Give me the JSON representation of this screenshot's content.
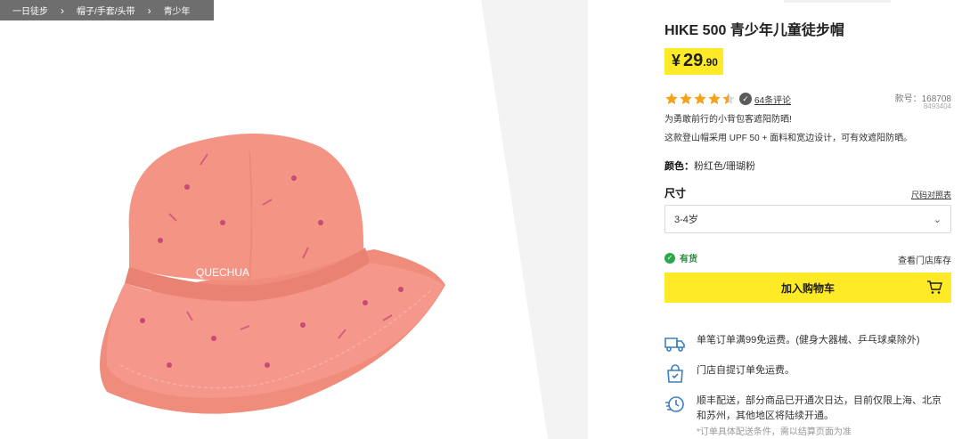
{
  "breadcrumb": [
    "一日徒步",
    "帽子/手套/头带",
    "青少年"
  ],
  "product": {
    "title": "HIKE 500 青少年儿童徒步帽",
    "price_currency": "¥",
    "price_int": "29",
    "price_dec": ".90",
    "rating": 4.5,
    "review_count": "64",
    "review_link": "64条评论",
    "item_no_label": "款号：168708",
    "item_code": "8493404",
    "tagline": "为勇敢前行的小背包客遮阳防晒!",
    "description": "这款登山帽采用 UPF 50 + 面料和宽边设计，可有效遮阳防晒。",
    "hat_label": "QUECHUA"
  },
  "color": {
    "label": "颜色：",
    "value": "粉红色/珊瑚粉"
  },
  "size": {
    "label": "尺寸",
    "guide": "尺码对照表",
    "selected": "3-4岁"
  },
  "stock": {
    "status": "有货",
    "store_link": "查看门店库存"
  },
  "cart_button": "加入购物车",
  "services": [
    {
      "icon": "truck-icon",
      "text": "单笔订单满99免运费。(健身大器械、乒乓球桌除外)"
    },
    {
      "icon": "store-pickup-icon",
      "text": "门店自提订单免运费。"
    },
    {
      "icon": "fast-delivery-icon",
      "text": "顺丰配送，部分商品已开通次日达，目前仅限上海、北京和苏州，其他地区将陆续开通。"
    }
  ],
  "note": "*订单具体配送条件，需以结算页面为准",
  "colors": {
    "accent_yellow": "#ffea28",
    "star": "#f7a21b",
    "hat_pink": "#f49484",
    "stock_green": "#2aa84a",
    "icon_blue": "#3c7fc1"
  }
}
